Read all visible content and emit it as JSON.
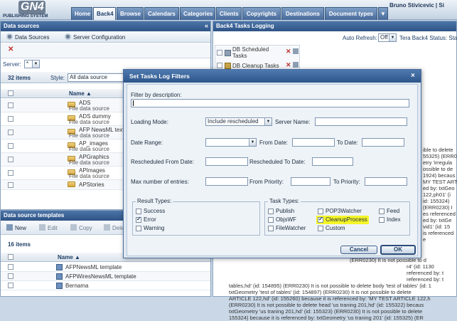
{
  "header": {
    "logo_text": "GN4",
    "logo_sub": "PUBLISHING SYSTEM",
    "user_name": "Bruno Stivicevic | Si",
    "tabs": [
      "Home",
      "Back4",
      "Browse",
      "Calendars",
      "Categories",
      "Clients",
      "Copyrights",
      "Destinations",
      "Document types",
      "▼"
    ]
  },
  "left_panel": {
    "title": "Data sources",
    "toolbar": {
      "data_sources": "Data Sources",
      "server_config": "Server Configuration"
    },
    "server_label": "Server:",
    "server_value": "*",
    "count": "32 items",
    "style_label": "Style:",
    "style_value": "All data source",
    "name_col": "Name ▲",
    "rows": [
      {
        "title": "ADS",
        "sub": "File data source"
      },
      {
        "title": "ADS dummy",
        "sub": "File data source"
      },
      {
        "title": "AFP NewsML text",
        "sub": "File data source"
      },
      {
        "title": "AP_images",
        "sub": "File data source"
      },
      {
        "title": "APGraphics",
        "sub": "File data source"
      },
      {
        "title": "APImages",
        "sub": "File data source"
      },
      {
        "title": "APStories",
        "sub": ""
      }
    ]
  },
  "templates_panel": {
    "title": "Data source templates",
    "toolbar": {
      "new": "New",
      "edit": "Edit",
      "copy": "Copy",
      "delete": "Dele"
    },
    "count": "16 items",
    "name_col": "Name ▲",
    "rows": [
      "AFPNewsML template",
      "AFPWiresNewsML template",
      "Bernama"
    ]
  },
  "right_panel": {
    "title": "Back4 Tasks Logging",
    "auto_refresh_label": "Auto Refresh:",
    "auto_refresh_value": "Off",
    "status": "Tera Back4 Status: Sta",
    "tasks": [
      "DB Scheduled Tasks",
      "DB Cleanup Tasks"
    ],
    "log_right": [
      "ible to delete",
      "55325) (ERR0",
      "etry 'irregula",
      "ossible to de",
      "1924) becaus",
      "MY TEST ART",
      "ed by: txtGeo",
      "122,ph01' (i",
      "id: 155324)",
      "(ERR0230) I",
      "es referenced",
      "ed by: txtGe",
      "vid1' (id: 15",
      "is referenced",
      "e"
    ],
    "log_bottom": [
      "(ERR0230) It is not possible to d",
      "r4' (id: 1130",
      "referenced by: t",
      "referenced by: t",
      "tables,hd' (id: 154895) (ERR0230) It is not possible to delete body 'test of tables' (id: 1",
      "txtGeometry 'test of tables' (id: 154897) (ERR0230) It is not possible to delete",
      "ARTICLE 122,hd' (id: 155260) because it is referenced by: 'MY TEST ARTICLE 122,h",
      "(ERR0230) It is not possible to delete head 'us traning 201,hd' (id: 155322) becaus",
      "txtGeometry 'us traning 201,hd' (id: 155323) (ERR0230) It is not possible to delete",
      "155324) because it is referenced by: txtGeometry 'us traning 201' (id: 155325) (ER"
    ]
  },
  "dialog": {
    "title": "Set Tasks Log Filters",
    "filter_desc_label": "Filter by description:",
    "filter_desc_value": "",
    "loading_mode_label": "Loading Mode:",
    "loading_mode_value": "Include rescheduled",
    "server_name_label": "Server Name:",
    "date_range_label": "Date Range:",
    "from_date_label": "From Date:",
    "to_date_label": "To Date:",
    "resched_from_label": "Rescheduled From Date:",
    "resched_to_label": "Rescheduled To Date:",
    "max_entries_label": "Max number of entries:",
    "from_priority_label": "From Priority:",
    "to_priority_label": "To Priority:",
    "result_types_label": "Result Types:",
    "result_types": [
      {
        "label": "Success",
        "checked": false
      },
      {
        "label": "Error",
        "checked": true
      },
      {
        "label": "Warning",
        "checked": false
      }
    ],
    "task_types_label": "Task Types:",
    "task_types": [
      {
        "label": "Publish",
        "checked": false
      },
      {
        "label": "ObjsWF",
        "checked": false
      },
      {
        "label": "FileWatcher",
        "checked": false
      },
      {
        "label": "POP3Watcher",
        "checked": false
      },
      {
        "label": "CleanupProcess",
        "checked": true,
        "highlight": "#f5f52a"
      },
      {
        "label": "Custom",
        "checked": false
      },
      {
        "label": "Feed",
        "checked": false
      },
      {
        "label": "Index",
        "checked": false
      }
    ],
    "cancel_label": "Cancel",
    "ok_label": "OK"
  },
  "colors": {
    "header_blue": "#2e5386",
    "highlight": "#f5f52a"
  }
}
